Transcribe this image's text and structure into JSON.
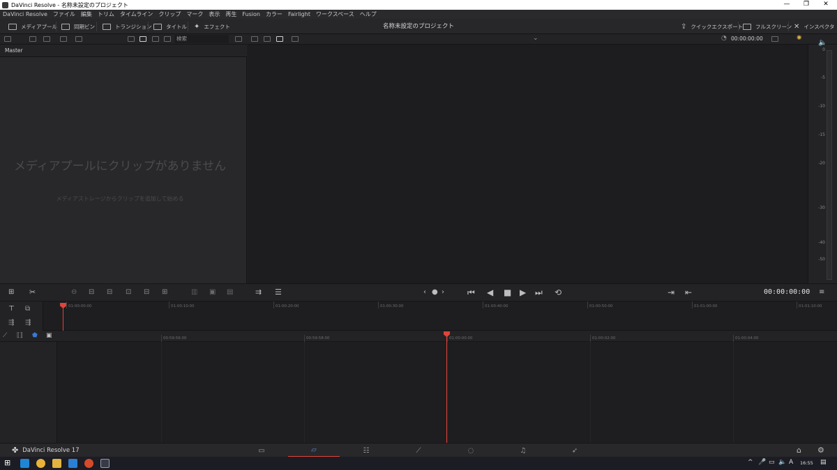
{
  "window": {
    "title": "DaVinci Resolve - 名称未設定のプロジェクト",
    "minimize": "—",
    "restore": "❐",
    "close": "✕"
  },
  "menu": [
    "DaVinci Resolve",
    "ファイル",
    "編集",
    "トリム",
    "タイムライン",
    "クリップ",
    "マーク",
    "表示",
    "再生",
    "Fusion",
    "カラー",
    "Fairlight",
    "ワークスペース",
    "ヘルプ"
  ],
  "toolbar": {
    "media_pool": "メディアプール",
    "sync_bin": "同期ビン",
    "transitions": "トランジション",
    "titles": "タイトル",
    "effects": "エフェクト",
    "project_title": "名称未設定のプロジェクト",
    "quick_export": "クイックエクスポート",
    "fullscreen": "フルスクリーン",
    "inspector": "インスペクタ"
  },
  "subbar": {
    "search_placeholder": "検索",
    "timecode": "00:00:00:00"
  },
  "media_pool": {
    "bin": "Master",
    "empty_title": "メディアプールにクリップがありません",
    "empty_sub": "メディアストレージからクリップを追加して始める"
  },
  "meter": {
    "ticks": [
      "0",
      "-5",
      "-10",
      "-15",
      "-20",
      "-30",
      "-40",
      "-50"
    ]
  },
  "transport": {
    "timecode": "00:00:00:00"
  },
  "timeline": {
    "upper_ruler": [
      "01:00:00:00",
      "01:00:10:00",
      "01:00:20:00",
      "01:00:30:00",
      "01:00:40:00",
      "01:00:50:00",
      "01:01:00:00",
      "01:01:10:00"
    ],
    "lower_ruler": [
      "00:59:56:00",
      "00:59:58:00",
      "01:00:00:00",
      "01:00:02:00",
      "01:00:04:00"
    ]
  },
  "pagebar": {
    "brand": "DaVinci Resolve 17",
    "pages": [
      "media-page",
      "cut-page",
      "edit-page",
      "fusion-page",
      "color-page",
      "fairlight-page",
      "deliver-page"
    ],
    "active_page": "cut-page"
  },
  "taskbar": {
    "clock": "16:55",
    "ime": "A"
  },
  "colors": {
    "accent": "#e0443a",
    "active_page_icon": "#5e8bd6"
  }
}
